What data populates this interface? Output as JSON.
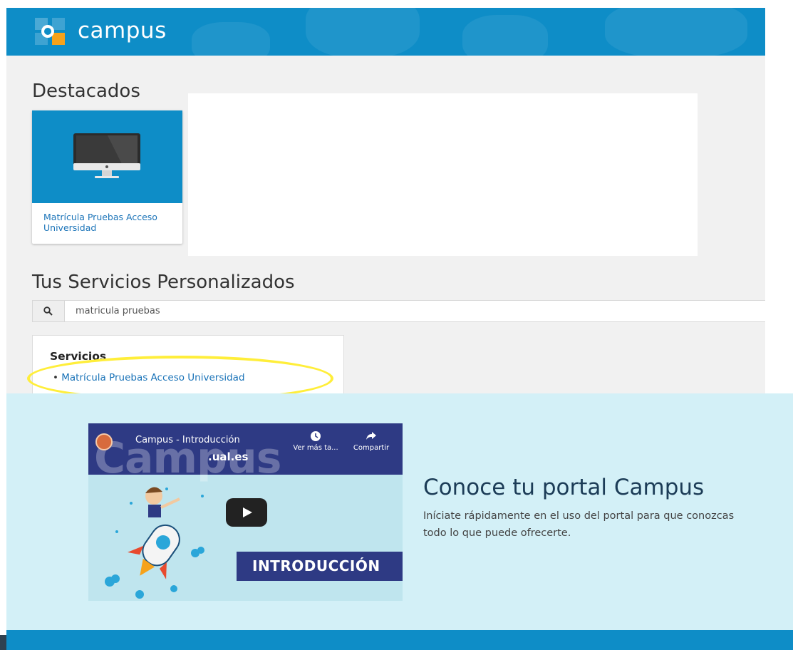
{
  "header": {
    "app_name": "campus"
  },
  "featured": {
    "title": "Destacados",
    "cards": [
      {
        "label": "Matrícula Pruebas Acceso Universidad",
        "icon": "monitor-icon"
      }
    ]
  },
  "personal_services": {
    "title": "Tus Servicios Personalizados",
    "search": {
      "value": "matricula pruebas",
      "icon": "search-icon"
    },
    "results": {
      "heading": "Servicios",
      "items": [
        {
          "label": "Matrícula Pruebas Acceso Universidad"
        }
      ]
    }
  },
  "promo": {
    "title": "Conoce tu portal Campus",
    "description": "Iníciate rápidamente en el uso del portal para que conozcas todo lo que puede ofrecerte.",
    "video": {
      "title": "Campus - Introducción",
      "watermark": "Campus",
      "domain": ".ual.es",
      "watch_later_label": "Ver más ta...",
      "share_label": "Compartir",
      "banner": "INTRODUCCIÓN"
    }
  },
  "colors": {
    "brand_blue": "#0e8dc7",
    "promo_bg": "#d3f0f7",
    "link_blue": "#1a73b8",
    "highlight_yellow": "#ffee3a",
    "video_navy": "#2e3a84"
  }
}
